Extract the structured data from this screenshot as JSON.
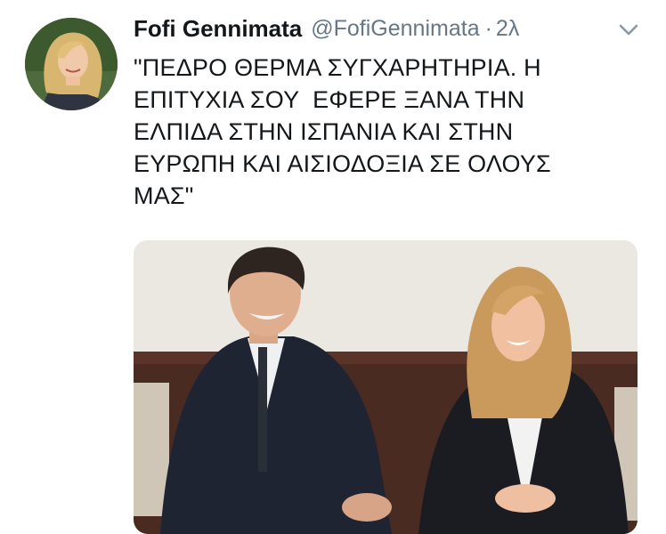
{
  "tweet": {
    "display_name": "Fofi Gennimata",
    "handle": "@FofiGennimata",
    "separator": "·",
    "time": "2λ",
    "text_lines": [
      "\"ΠΕΔΡΟ ΘΕΡΜΑ ΣΥΓΧΑΡΗΤΗΡΙΑ. Η",
      "ΕΠΙΤΥΧΙΑ ΣΟΥ  ΕΦΕΡΕ ΞΑΝΑ ΤΗΝ",
      "ΕΛΠΙΔΑ ΣΤΗΝ ΙΣΠΑΝΙΑ ΚΑΙ ΣΤΗΝ",
      "ΕΥΡΩΠΗ ΚΑΙ ΑΙΣΙΟΔΟΞΙΑ ΣΕ ΟΛΟΥΣ",
      "ΜΑΣ\""
    ],
    "icons": {
      "avatar": "profile-photo",
      "caret": "chevron-down-icon"
    }
  },
  "colors": {
    "name": "#14171a",
    "secondary": "#657786",
    "text": "#14171a",
    "background": "#ffffff"
  }
}
